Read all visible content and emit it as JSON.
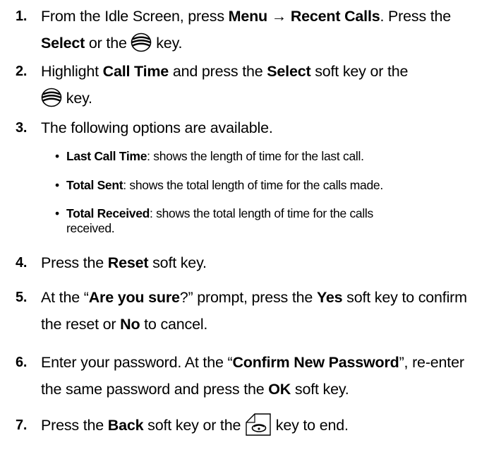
{
  "steps": [
    {
      "num": "1.",
      "t1": "From the Idle Screen, press ",
      "b1": "Menu → Recent Calls",
      "t2": ". Press the ",
      "b2": "Select",
      "t3": " or the ",
      "t4": " key."
    },
    {
      "num": "2.",
      "t1": "Highlight ",
      "b1": "Call Time",
      "t2": " and press the ",
      "b2": "Select",
      "t3": " soft key or the ",
      "t4": " key."
    },
    {
      "num": "3.",
      "t1": "The following options are available."
    },
    {
      "num": "4.",
      "t1": "Press the ",
      "b1": "Reset",
      "t2": " soft key."
    },
    {
      "num": "5.",
      "t1": "At the “",
      "b1": "Are you sure",
      "t2": "?” prompt, press the ",
      "b2": "Yes",
      "t3": " soft key to confirm the reset or ",
      "b3": "No",
      "t4": " to cancel."
    },
    {
      "num": "6.",
      "t1": "Enter your password. At the “",
      "b1": "Confirm New Password",
      "t2": "”, re-enter the same password and press the ",
      "b2": "OK",
      "t3": " soft key."
    },
    {
      "num": "7.",
      "t1": "Press the ",
      "b1": "Back",
      "t2": " soft key or the ",
      "t3": " key to end."
    }
  ],
  "options": [
    {
      "bullet": "•",
      "bold": "Last Call Time",
      "text": ": shows the length of time for the last call."
    },
    {
      "bullet": "•",
      "bold": "Total Sent",
      "text": ": shows the total length of time for the calls made."
    },
    {
      "bullet": "•",
      "bold": "Total Received",
      "text": ": shows the total length of time for the calls received."
    }
  ],
  "icons": {
    "nav_key": "navigation-key-icon",
    "end_key": "end-key-icon"
  }
}
